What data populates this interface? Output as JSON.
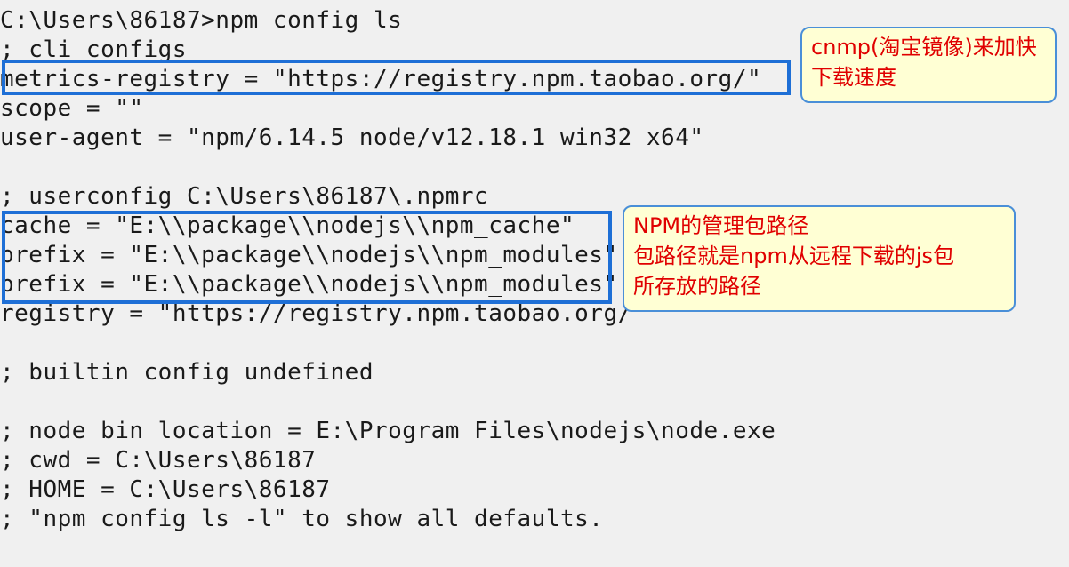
{
  "terminal": {
    "lines": [
      "C:\\Users\\86187>npm config ls",
      "; cli configs",
      "metrics-registry = \"https://registry.npm.taobao.org/\"",
      "scope = \"\"",
      "user-agent = \"npm/6.14.5 node/v12.18.1 win32 x64\"",
      "",
      "; userconfig C:\\Users\\86187\\.npmrc",
      "cache = \"E:\\\\package\\\\nodejs\\\\npm_cache\"",
      "prefix = \"E:\\\\package\\\\nodejs\\\\npm_modules\"",
      "prefix = \"E:\\\\package\\\\nodejs\\\\npm_modules\"",
      "registry = \"https://registry.npm.taobao.org/\"",
      "",
      "; builtin config undefined",
      "",
      "; node bin location = E:\\Program Files\\nodejs\\node.exe",
      "; cwd = C:\\Users\\86187",
      "; HOME = C:\\Users\\86187",
      "; \"npm config ls -l\" to show all defaults."
    ]
  },
  "callouts": {
    "mirror": {
      "line1": "cnmp(淘宝镜像)来加快",
      "line2": "下载速度"
    },
    "package_path": {
      "line1": "NPM的管理包路径",
      "line2": "包路径就是npm从远程下载的js包",
      "line3": "所存放的路径"
    }
  },
  "colors": {
    "highlight_border": "#1e6fd6",
    "callout_text": "#e00000",
    "callout_bg": "#ffffd4",
    "background": "#f0f0f0"
  }
}
